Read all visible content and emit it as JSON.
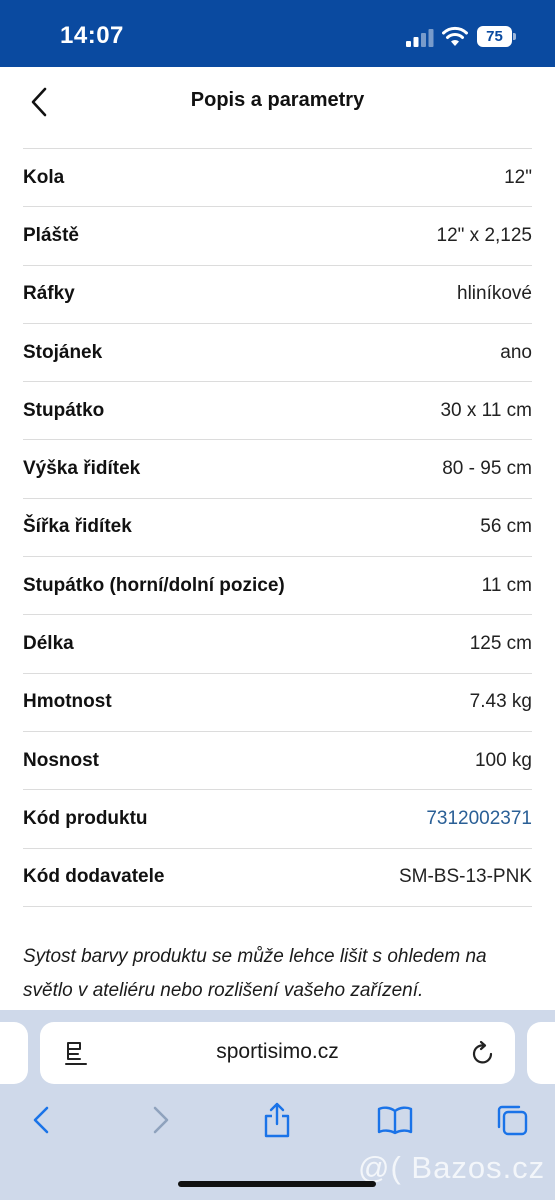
{
  "status_bar": {
    "time": "14:07",
    "battery": "75",
    "icons": [
      "signal-icon",
      "wifi-icon",
      "battery-icon"
    ],
    "background_color": "#0a4aa0"
  },
  "header": {
    "title": "Popis a parametry",
    "back_icon": "chevron-left-icon"
  },
  "specs": [
    {
      "label": "Kola",
      "value": "12\""
    },
    {
      "label": "Pláště",
      "value": "12\" x 2,125"
    },
    {
      "label": "Ráfky",
      "value": "hliníkové"
    },
    {
      "label": "Stojánek",
      "value": "ano"
    },
    {
      "label": "Stupátko",
      "value": "30 x 11 cm"
    },
    {
      "label": "Výška řidítek",
      "value": "80 - 95 cm"
    },
    {
      "label": "Šířka řidítek",
      "value": "56 cm"
    },
    {
      "label": "Stupátko (horní/dolní pozice)",
      "value": "11 cm"
    },
    {
      "label": "Délka",
      "value": "125 cm"
    },
    {
      "label": "Hmotnost",
      "value": "7.43 kg"
    },
    {
      "label": "Nosnost",
      "value": "100 kg"
    },
    {
      "label": "Kód produktu",
      "value": "7312002371"
    },
    {
      "label": "Kód dodavatele",
      "value": "SM-BS-13-PNK"
    }
  ],
  "link_color": "#2a5f96",
  "disclaimer": "Sytost barvy produktu se může lehce lišit s ohledem na světlo v ateliéru nebo rozlišení vašeho zařízení.",
  "browser": {
    "address": "sportisimo.cz",
    "toolbar_icons": [
      "back-icon",
      "forward-icon",
      "share-icon",
      "bookmarks-icon",
      "tabs-icon"
    ],
    "watermark": "@( Bazos.cz"
  }
}
